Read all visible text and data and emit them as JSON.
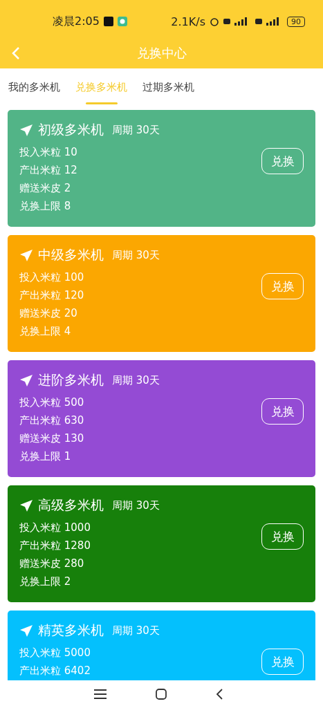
{
  "status_bar": {
    "time": "凌晨2:05",
    "speed": "2.1K/s",
    "battery": "90"
  },
  "header": {
    "title": "兑换中心"
  },
  "tabs": [
    {
      "label": "我的多米机",
      "selected": false
    },
    {
      "label": "兑换多米机",
      "selected": true
    },
    {
      "label": "过期多米机",
      "selected": false
    }
  ],
  "machines": [
    {
      "name": "初级多米机",
      "period": "周期 30天",
      "color": "#52b487",
      "lines": [
        "投入米粒 10",
        "产出米粒 12",
        "赠送米皮 2",
        "兑换上限 8"
      ],
      "button": "兑换"
    },
    {
      "name": "中级多米机",
      "period": "周期 30天",
      "color": "#fba701",
      "lines": [
        "投入米粒 100",
        "产出米粒 120",
        "赠送米皮 20",
        "兑换上限 4"
      ],
      "button": "兑换"
    },
    {
      "name": "进阶多米机",
      "period": "周期 30天",
      "color": "#944bd4",
      "lines": [
        "投入米粒 500",
        "产出米粒 630",
        "赠送米皮 130",
        "兑换上限 1"
      ],
      "button": "兑换"
    },
    {
      "name": "高级多米机",
      "period": "周期 30天",
      "color": "#17800b",
      "lines": [
        "投入米粒 1000",
        "产出米粒 1280",
        "赠送米皮 280",
        "兑换上限 2"
      ],
      "button": "兑换"
    },
    {
      "name": "精英多米机",
      "period": "周期 30天",
      "color": "#04c0fd",
      "lines": [
        "投入米粒 5000",
        "产出米粒 6402"
      ],
      "button": "兑换"
    }
  ]
}
